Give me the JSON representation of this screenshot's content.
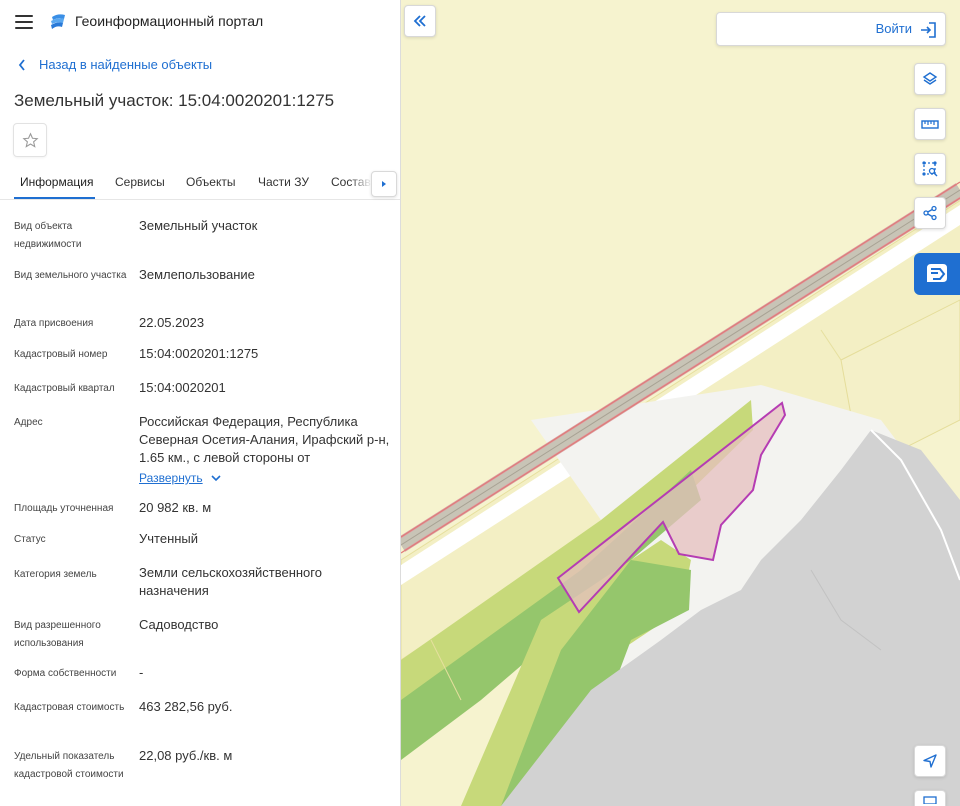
{
  "header": {
    "app_title": "Геоинформационный портал",
    "menu_icon": "hamburger-icon",
    "logo_icon": "portal-logo-icon"
  },
  "nav": {
    "back_label": "Назад в найденные объекты"
  },
  "object": {
    "title": "Земельный участок: 15:04:0020201:1275"
  },
  "tabs": [
    {
      "label": "Информация",
      "active": true
    },
    {
      "label": "Сервисы",
      "active": false
    },
    {
      "label": "Объекты",
      "active": false
    },
    {
      "label": "Части ЗУ",
      "active": false
    },
    {
      "label": "Состав",
      "active": false
    }
  ],
  "fields": [
    {
      "label": "Вид объекта недвижимости",
      "value": "Земельный участок"
    },
    {
      "label": "Вид земельного участка",
      "value": "Землепользование"
    },
    {
      "label": "Дата присвоения",
      "value": "22.05.2023"
    },
    {
      "label": "Кадастровый номер",
      "value": "15:04:0020201:1275"
    },
    {
      "label": "Кадастровый квартал",
      "value": "15:04:0020201"
    },
    {
      "label": "Адрес",
      "value": "Российская Федерация, Республика Северная Осетия-Алания, Ирафский р-н, 1.65 км., с левой стороны от"
    },
    {
      "label": "Площадь уточненная",
      "value": "20 982 кв. м"
    },
    {
      "label": "Статус",
      "value": "Учтенный"
    },
    {
      "label": "Категория земель",
      "value": "Земли сельскохозяйственного назначения"
    },
    {
      "label": "Вид разрешенного использования",
      "value": "Садоводство"
    },
    {
      "label": "Форма собственности",
      "value": "-"
    },
    {
      "label": "Кадастровая стоимость",
      "value": "463 282,56 руб."
    },
    {
      "label": "Удельный показатель кадастровой стоимости",
      "value": "22,08 руб./кв. м"
    }
  ],
  "address_expand_label": "Развернуть",
  "map": {
    "login_label": "Войти",
    "colors": {
      "background": "#f6f3cf",
      "road_gray": "#e3e3e3",
      "green_light": "#c3d77a",
      "green_dark": "#8fc06a",
      "parcel_fill": "#e6bfbf",
      "parcel_stroke": "#b53cb3",
      "road_red": "#e07a7a",
      "accent": "#1f6fd1"
    },
    "tools": [
      "layers-icon",
      "ruler-icon",
      "select-area-icon",
      "share-icon",
      "locate-icon"
    ]
  }
}
